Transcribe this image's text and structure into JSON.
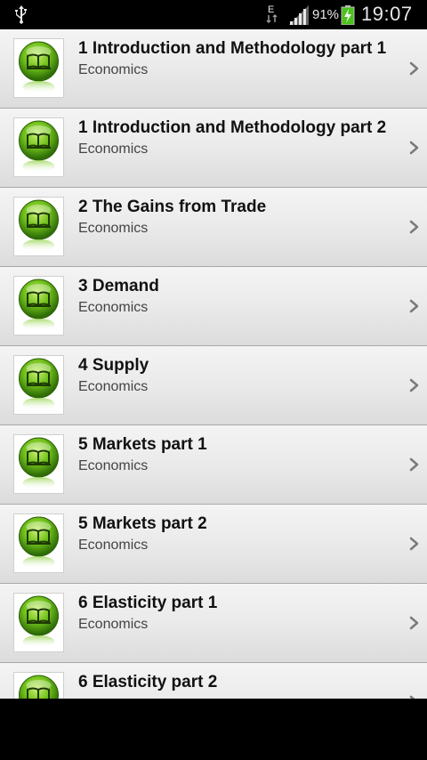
{
  "status_bar": {
    "data_indicator": "E",
    "battery_percent": "91%",
    "time": "19:07"
  },
  "icons": {
    "usb": "usb-icon",
    "data": "data-transfer-icon",
    "signal": "signal-icon",
    "battery": "battery-charging-icon",
    "thumbnail": "book-icon",
    "chevron": "chevron-right-icon"
  },
  "colors": {
    "accent_green": "#6fbf1a",
    "status_bar": "#000000",
    "battery_green": "#4cc21d"
  },
  "list": {
    "items": [
      {
        "title": "1 Introduction and Methodology part 1",
        "subtitle": "Economics"
      },
      {
        "title": "1 Introduction and Methodology part 2",
        "subtitle": "Economics"
      },
      {
        "title": "2 The Gains from Trade",
        "subtitle": "Economics"
      },
      {
        "title": "3 Demand",
        "subtitle": "Economics"
      },
      {
        "title": "4 Supply",
        "subtitle": "Economics"
      },
      {
        "title": "5 Markets part 1",
        "subtitle": "Economics"
      },
      {
        "title": "5 Markets part 2",
        "subtitle": "Economics"
      },
      {
        "title": "6 Elasticity part 1",
        "subtitle": "Economics"
      },
      {
        "title": "6 Elasticity part 2",
        "subtitle": ""
      }
    ]
  }
}
